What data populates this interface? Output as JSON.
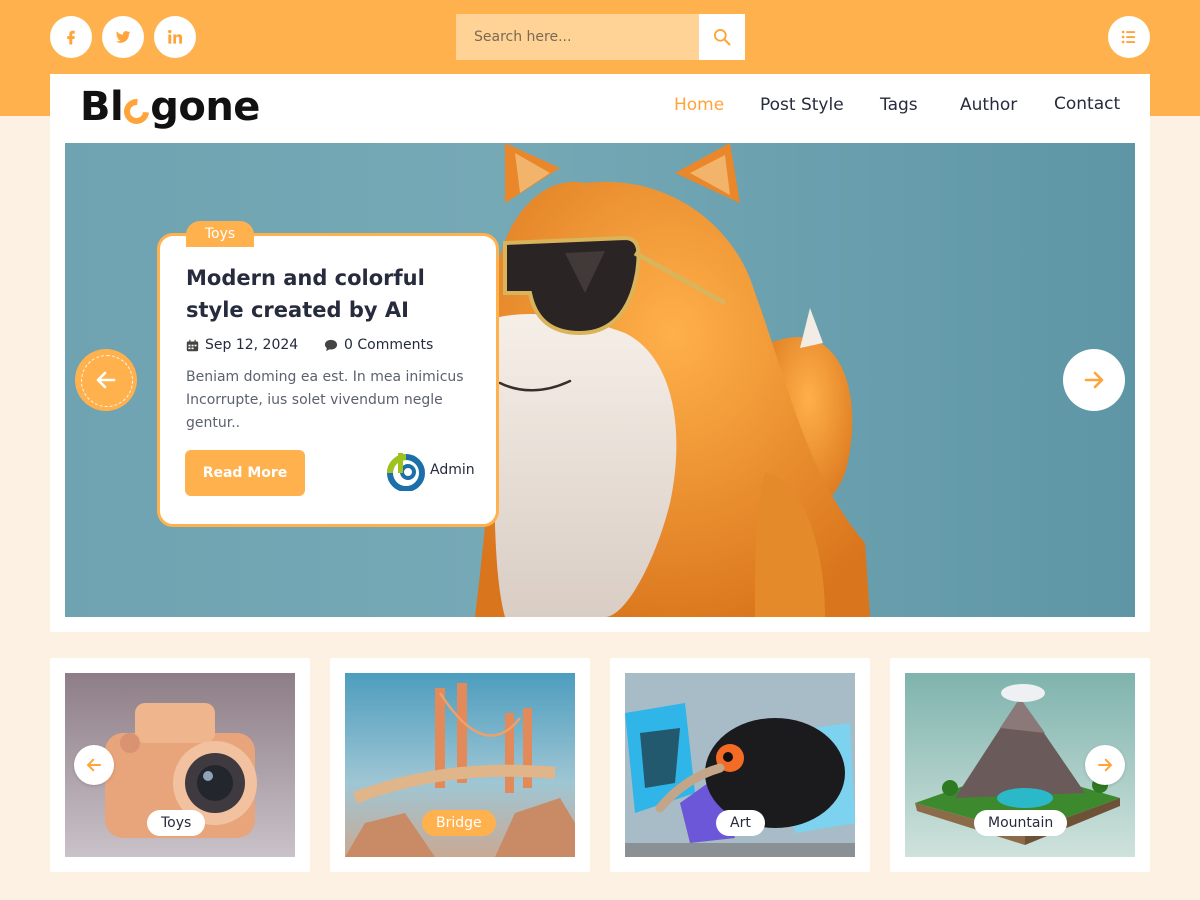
{
  "colors": {
    "accent": "#ffb14e",
    "accent_dark": "#ffa43a",
    "text": "#262b3d",
    "background": "#fdf1e3"
  },
  "social": [
    {
      "name": "facebook",
      "icon": "facebook-icon"
    },
    {
      "name": "twitter",
      "icon": "twitter-icon"
    },
    {
      "name": "linkedin",
      "icon": "linkedin-icon"
    }
  ],
  "search": {
    "placeholder": "Search here...",
    "value": ""
  },
  "logo": {
    "part1": "Bl",
    "part2": "gone"
  },
  "nav": {
    "items": [
      {
        "label": "Home",
        "active": true
      },
      {
        "label": "Post Style",
        "active": false
      },
      {
        "label": "Tags",
        "active": false
      },
      {
        "label": "Author",
        "active": false
      },
      {
        "label": "Contact",
        "active": false
      }
    ]
  },
  "hero": {
    "category": "Toys",
    "title": "Modern and colorful style created by AI",
    "date": "Sep 12, 2024",
    "comments": "0 Comments",
    "excerpt": "Beniam doming ea est. In mea inimicus Incorrupte, ius solet vivendum negle gentur..",
    "read_more": "Read More",
    "author": "Admin"
  },
  "thumbs": [
    {
      "label": "Toys",
      "style": "white"
    },
    {
      "label": "Bridge",
      "style": "orange"
    },
    {
      "label": "Art",
      "style": "white"
    },
    {
      "label": "Mountain",
      "style": "white"
    }
  ]
}
